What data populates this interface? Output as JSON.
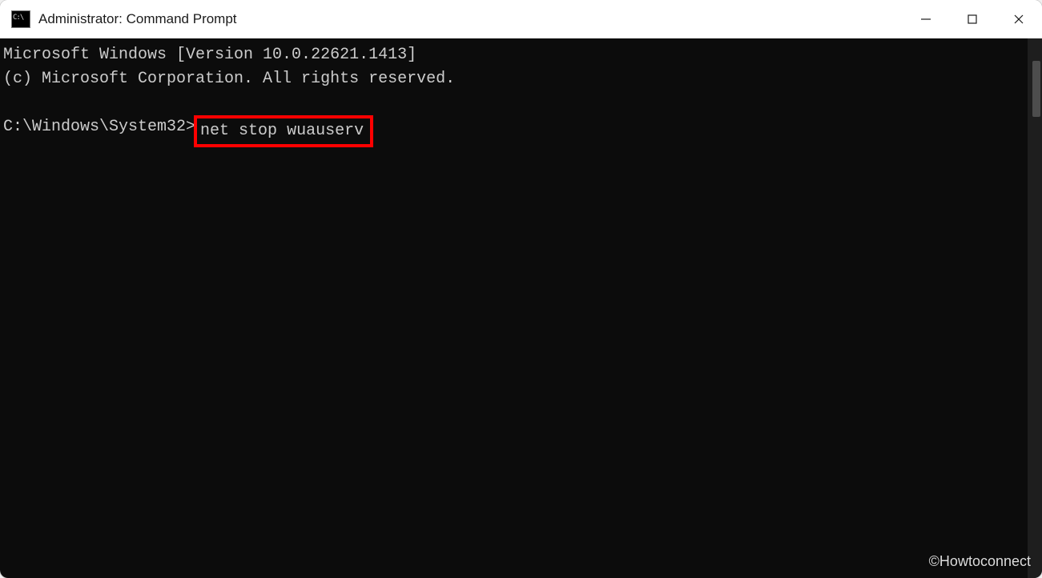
{
  "window": {
    "title": "Administrator: Command Prompt"
  },
  "terminal": {
    "header_line1": "Microsoft Windows [Version 10.0.22621.1413]",
    "header_line2": "(c) Microsoft Corporation. All rights reserved.",
    "prompt": "C:\\Windows\\System32>",
    "command": "net stop wuauserv"
  },
  "watermark": "©Howtoconnect"
}
